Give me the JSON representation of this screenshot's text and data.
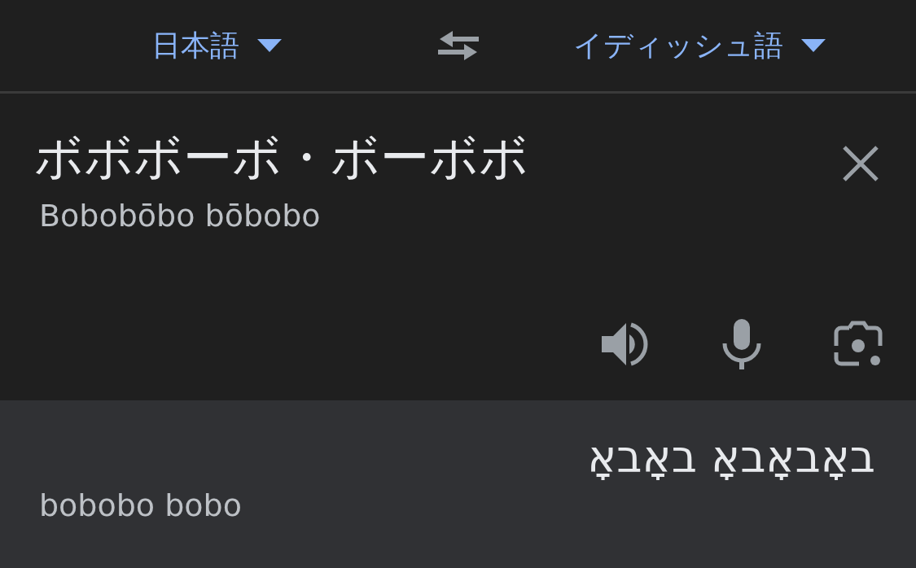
{
  "languages": {
    "source": {
      "label": "日本語"
    },
    "target": {
      "label": "イディッシュ語"
    }
  },
  "source": {
    "text": "ボボボーボ・ボーボボ",
    "romanization": "Bobobōbo bōbobo"
  },
  "result": {
    "text": "באָבאָבאָ באָבאָ",
    "romanization": "bobobo bobo"
  }
}
